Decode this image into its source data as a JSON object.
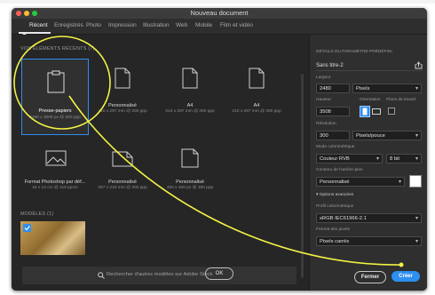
{
  "window": {
    "title": "Nouveau document"
  },
  "tabs": [
    "Récent",
    "Enregistrés",
    "Photo",
    "Impression",
    "Illustration",
    "Web",
    "Mobile",
    "Film et vidéo"
  ],
  "recent": {
    "header": "VOS ÉLÉMENTS RÉCENTS",
    "count": "(7)",
    "items": [
      {
        "label": "Presse-papiers",
        "sub": "2480 x 3508 px @ 300 ppp"
      },
      {
        "label": "Personnalisé",
        "sub": "210 x 297 mm @ 300 ppp"
      },
      {
        "label": "A4",
        "sub": "210 x 297 mm @ 300 ppp"
      },
      {
        "label": "A4",
        "sub": "210 x 297 mm @ 300 ppp"
      },
      {
        "label": "Format Photoshop par déf...",
        "sub": "16 x 12 cm @ 118 ppcm"
      },
      {
        "label": "Personnalisé",
        "sub": "297 x 210 mm @ 300 ppp"
      },
      {
        "label": "Personnalisé",
        "sub": "400 x 400 px @ 300 ppp"
      }
    ]
  },
  "templates": {
    "header": "MODÈLES",
    "count": "(1)"
  },
  "search": {
    "placeholder": "Rechercher d'autres modèles sur Adobe Stock",
    "ok": "OK"
  },
  "panel": {
    "heading": "DÉTAILS DU PARAMÈTRE PRÉDÉFINI",
    "name": "Sans titre-2",
    "width_label": "Largeur",
    "width_value": "2480",
    "width_unit": "Pixels",
    "height_label": "Hauteur",
    "height_value": "3508",
    "orientation_label": "Orientation",
    "artboards_label": "Plans de travail",
    "resolution_label": "Résolution",
    "resolution_value": "300",
    "resolution_unit": "Pixels/pouce",
    "color_mode_label": "Mode colorimétrique",
    "color_mode_value": "Couleur RVB",
    "bit_value": "8 bit",
    "bg_label": "Contenu de l'arrière-plan",
    "bg_value": "Personnalisé",
    "advanced": "Options avancées",
    "profile_label": "Profil colorimétrique",
    "profile_value": "sRGB IEC61966-2.1",
    "pixel_label": "Format des pixels",
    "pixel_value": "Pixels carrés",
    "close": "Fermer",
    "create": "Créer"
  },
  "colors": {
    "accent": "#2d8ff0",
    "annotation": "#f2f244",
    "window_bg": "#262626",
    "panel_bg": "#2f2f2f"
  },
  "icons": [
    "clock-icon",
    "document-icon",
    "clipboard-icon",
    "image-icon",
    "save-preset-icon",
    "portrait-icon",
    "landscape-icon",
    "checkbox-icon",
    "search-icon",
    "checkmark-icon",
    "chevron-down-icon"
  ]
}
